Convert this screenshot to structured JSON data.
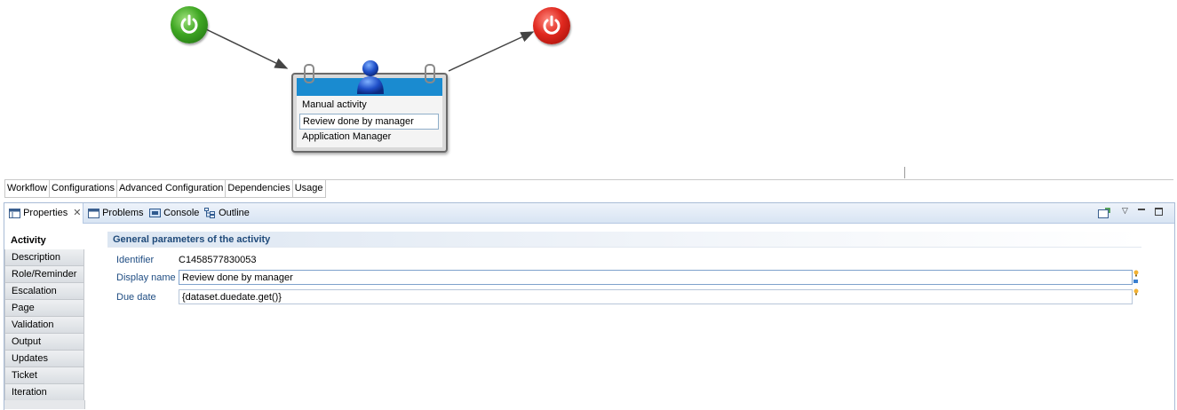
{
  "diagram": {
    "start_node": "power-on-icon",
    "end_node": "power-off-icon",
    "activity": {
      "type_label": "Manual activity",
      "name": "Review done by manager",
      "role": "Application Manager"
    }
  },
  "editor_tabs": [
    "Workflow",
    "Configurations",
    "Advanced Configuration",
    "Dependencies",
    "Usage"
  ],
  "panel_tabs": {
    "properties": "Properties",
    "problems": "Problems",
    "console": "Console",
    "outline": "Outline"
  },
  "side_nav": [
    "Activity",
    "Description",
    "Role/Reminder",
    "Escalation",
    "Page",
    "Validation",
    "Output",
    "Updates",
    "Ticket",
    "Iteration"
  ],
  "section": {
    "title": "General parameters of the activity",
    "identifier_label": "Identifier",
    "identifier_value": "C1458577830053",
    "display_name_label": "Display name",
    "display_name_value": "Review done by manager",
    "due_date_label": "Due date",
    "due_date_value": "{dataset.duedate.get()}"
  },
  "colors": {
    "accent": "#1a8bd0",
    "label": "#1e4c82",
    "start": "#3ea622",
    "end": "#e0281e"
  }
}
